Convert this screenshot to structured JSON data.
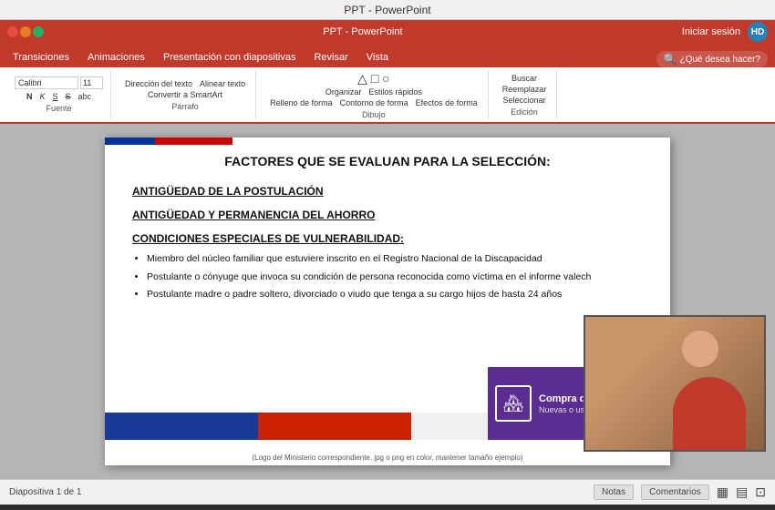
{
  "app": {
    "title": "PPT - PowerPoint"
  },
  "ribbon": {
    "tabs": [
      {
        "label": "Transiciones",
        "active": false
      },
      {
        "label": "Animaciones",
        "active": false
      },
      {
        "label": "Presentación con diapositivas",
        "active": false
      },
      {
        "label": "Revisar",
        "active": false
      },
      {
        "label": "Vista",
        "active": false
      }
    ],
    "search_placeholder": "¿Qué desea hacer?",
    "login_label": "Iniciar sesión",
    "user_initials": "HD",
    "groups": [
      {
        "label": "Fuente"
      },
      {
        "label": "Párrafo"
      },
      {
        "label": "Dibujo"
      },
      {
        "label": "Edición"
      }
    ],
    "buttons": {
      "buscar": "Buscar",
      "reemplazar": "Reemplazar",
      "seleccionar": "Seleccionar",
      "organizar": "Organizar",
      "estilos": "Estilos rápidos",
      "direccion": "Dirección del texto",
      "alinear": "Alinear texto",
      "convertir": "Convertir a SmartArt",
      "relleno": "Relleno de forma",
      "contorno": "Contorno de forma",
      "efectos": "Efectos de forma"
    }
  },
  "slide": {
    "title": "FACTORES QUE SE EVALUAN PARA LA SELECCIÓN:",
    "sections": [
      {
        "heading": "ANTIGÜEDAD DE LA POSTULACIÓN",
        "bullets": []
      },
      {
        "heading": "ANTIGÜEDAD Y PERMANENCIA DEL AHORRO",
        "bullets": []
      },
      {
        "heading": "CONDICIONES ESPECIALES DE VULNERABILIDAD:",
        "bullets": [
          "Miembro del núcleo familiar que estuviere inscrito en el Registro Nacional de la Discapacidad",
          "Postulante o cónyuge que invoca su condición de persona reconocida como víctima en el informe valech",
          "Postulante madre o padre soltero, divorciado o viudo que tenga a su cargo hijos de hasta 24 años"
        ]
      }
    ],
    "banner": {
      "title": "Compra de viviendas",
      "subtitle": "Nuevas o usadas"
    },
    "footer": "(Logo del Ministerio correspondiente, jpg o png en color, mantener tamaño ejemplo)"
  },
  "status_bar": {
    "notes_label": "Notas",
    "comments_label": "Comentarios"
  }
}
